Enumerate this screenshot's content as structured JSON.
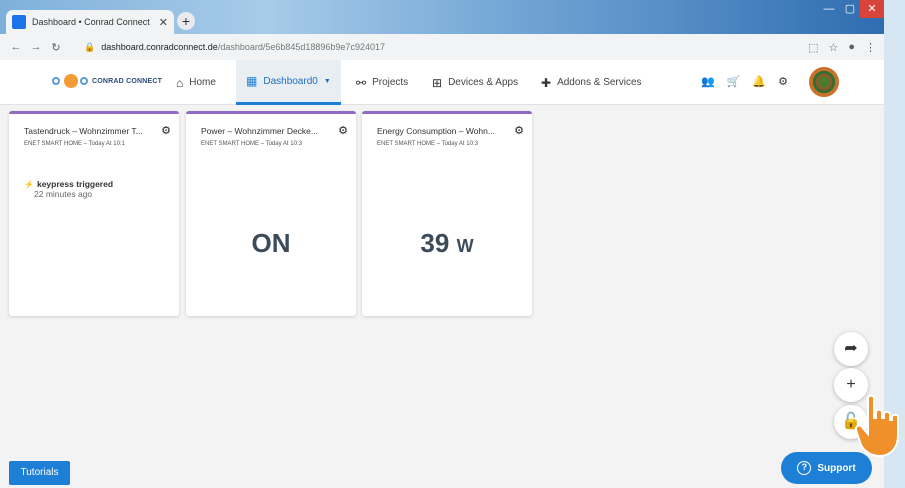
{
  "browser": {
    "tab_title": "Dashboard • Conrad Connect",
    "tab_close": "✕",
    "new_tab": "+",
    "url_host": "dashboard.conradconnect.de",
    "url_path": "/dashboard/5e6b845d18896b9e7c924017",
    "window_controls": {
      "min": "—",
      "max": "▢",
      "close": "✕"
    }
  },
  "header": {
    "logo_text": "CONRAD CONNECT",
    "nav": {
      "home": "Home",
      "dashboard": "Dashboard0",
      "projects": "Projects",
      "devices": "Devices & Apps",
      "addons": "Addons & Services"
    },
    "icons": [
      "users-icon",
      "cart-icon",
      "bell-icon",
      "gear-icon"
    ]
  },
  "cards": [
    {
      "title": "Tastendruck – Wohnzimmer T...",
      "subtitle": "ENET SMART HOME – Today At 10:1",
      "event_label": "keypress triggered",
      "event_time": "22 minutes ago"
    },
    {
      "title": "Power – Wohnzimmer Decke...",
      "subtitle": "ENET SMART HOME – Today At 10:3",
      "value": "ON"
    },
    {
      "title": "Energy Consumption – Wohn...",
      "subtitle": "ENET SMART HOME – Today At 10:3",
      "value": "39",
      "unit": "W"
    }
  ],
  "buttons": {
    "tutorials": "Tutorials",
    "support": "Support"
  },
  "colors": {
    "accent": "#1e7fd6",
    "card_top": "#8e6bbf",
    "hand": "#f0902a"
  }
}
